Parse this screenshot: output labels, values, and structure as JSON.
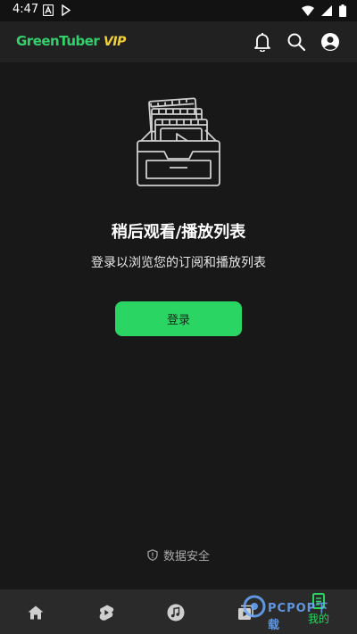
{
  "status_bar": {
    "time": "4:47"
  },
  "app_bar": {
    "logo_green": "GreenTuber",
    "logo_vip": "VIP",
    "icons": [
      "bell-icon",
      "search-icon",
      "account-icon"
    ]
  },
  "empty_state": {
    "title": "稍后观看/播放列表",
    "subtitle": "登录以浏览您的订阅和播放列表",
    "login_label": "登录"
  },
  "security_note": {
    "label": "数据安全"
  },
  "bottom_nav": {
    "items": [
      {
        "icon": "home-icon"
      },
      {
        "icon": "shorts-icon"
      },
      {
        "icon": "music-icon"
      },
      {
        "icon": "library-icon"
      },
      {
        "icon": "mine-icon",
        "label": "我的",
        "active": true
      }
    ]
  },
  "watermark": {
    "text": "PCPOP下载"
  },
  "colors": {
    "accent": "#2bd563",
    "background": "#181818",
    "app_bar": "#212121",
    "bottom_nav": "#2a2a2a",
    "vip": "#f2d03b"
  }
}
